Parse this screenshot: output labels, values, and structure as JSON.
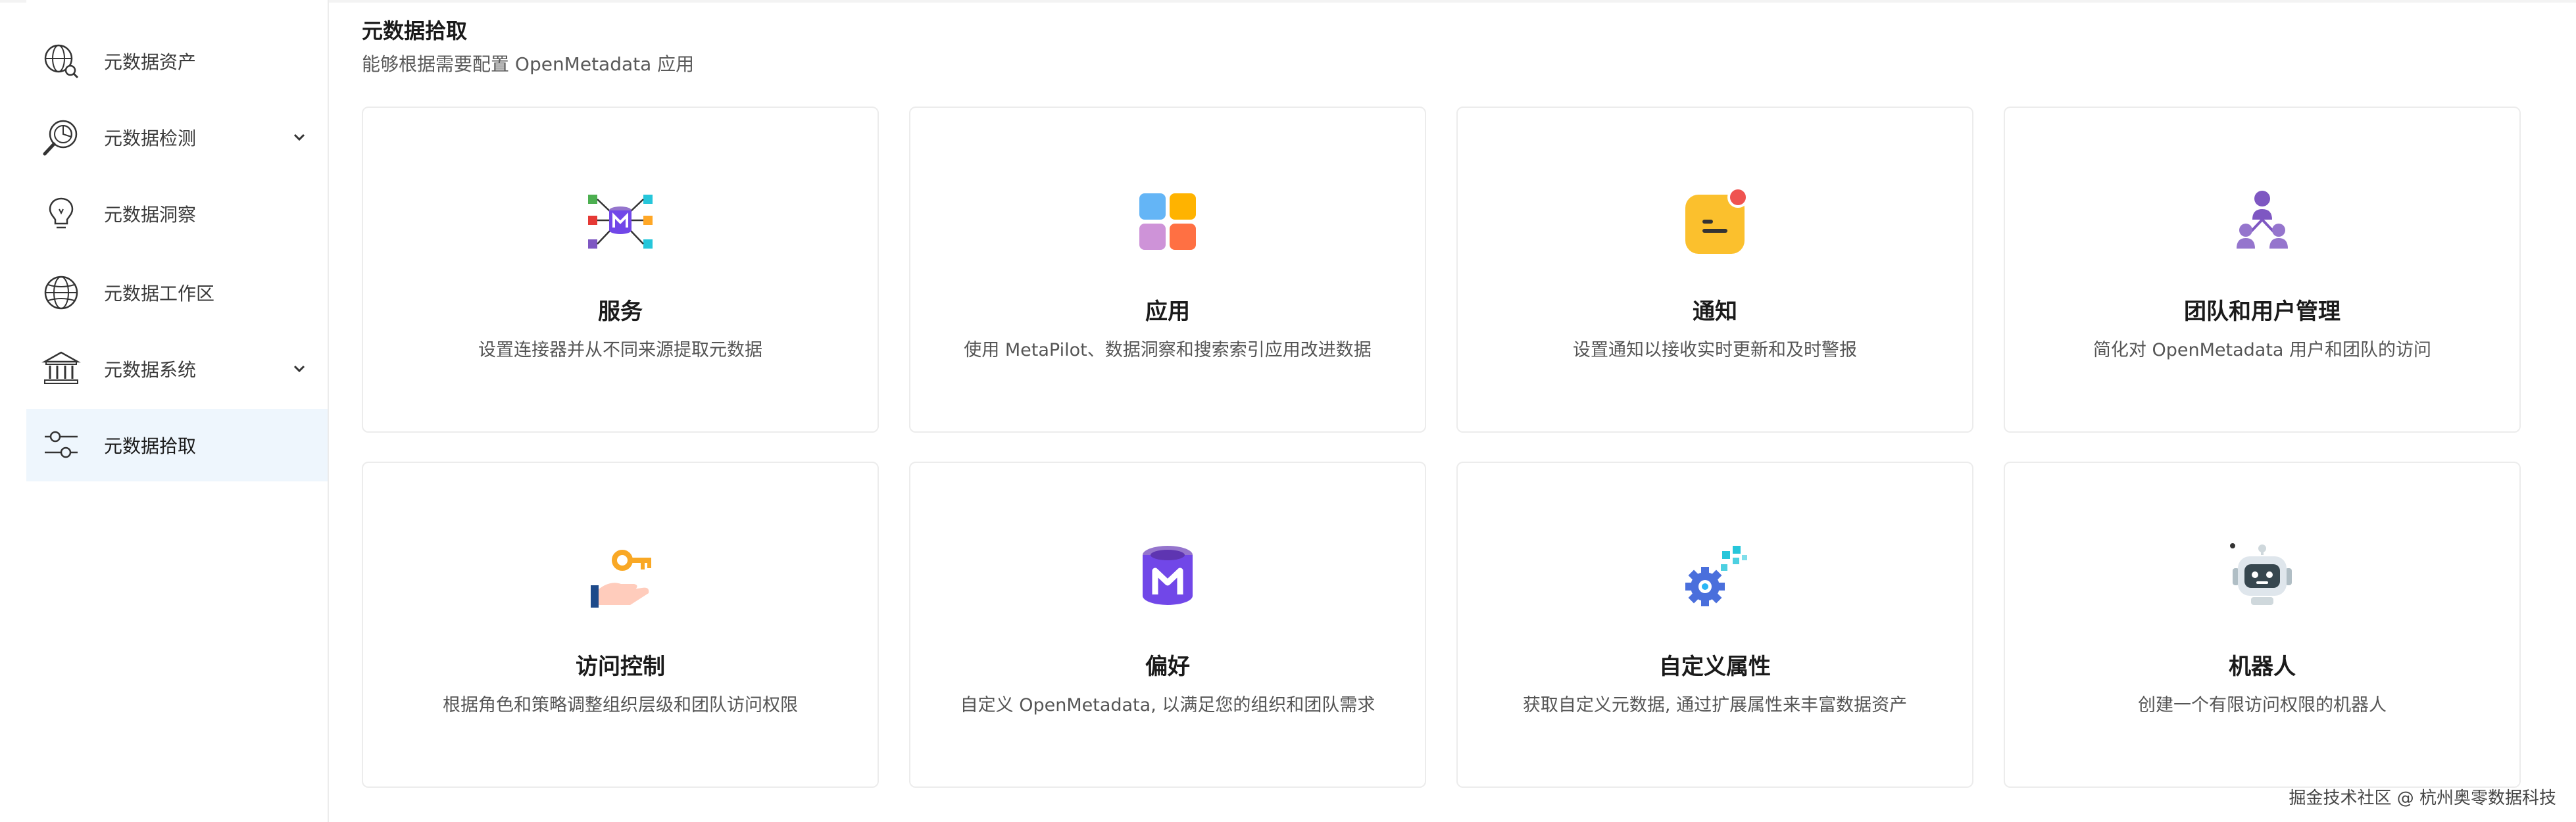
{
  "sidebar": {
    "items": [
      {
        "label": "元数据资产",
        "icon": "globe-search-icon",
        "expandable": false,
        "active": false
      },
      {
        "label": "元数据检测",
        "icon": "magnifier-chart-icon",
        "expandable": true,
        "active": false
      },
      {
        "label": "元数据洞察",
        "icon": "lightbulb-icon",
        "expandable": false,
        "active": false
      },
      {
        "label": "元数据工作区",
        "icon": "globe-icon",
        "expandable": false,
        "active": false
      },
      {
        "label": "元数据系统",
        "icon": "bank-building-icon",
        "expandable": true,
        "active": false
      },
      {
        "label": "元数据拾取",
        "icon": "sliders-icon",
        "expandable": false,
        "active": true
      }
    ]
  },
  "main": {
    "title": "元数据拾取",
    "subtitle": "能够根据需要配置 OpenMetadata 应用"
  },
  "cards": [
    {
      "title": "服务",
      "desc": "设置连接器并从不同来源提取元数据",
      "icon": "services-network-icon"
    },
    {
      "title": "应用",
      "desc": "使用 MetaPilot、数据洞察和搜索索引应用改进数据",
      "icon": "apps-grid-icon"
    },
    {
      "title": "通知",
      "desc": "设置通知以接收实时更新和及时警报",
      "icon": "notification-message-icon"
    },
    {
      "title": "团队和用户管理",
      "desc": "简化对 OpenMetadata 用户和团队的访问",
      "icon": "team-users-icon"
    },
    {
      "title": "访问控制",
      "desc": "根据角色和策略调整组织层级和团队访问权限",
      "icon": "key-hand-icon"
    },
    {
      "title": "偏好",
      "desc": "自定义 OpenMetadata, 以满足您的组织和团队需求",
      "icon": "openmetadata-logo-icon"
    },
    {
      "title": "自定义属性",
      "desc": "获取自定义元数据, 通过扩展属性来丰富数据资产",
      "icon": "gear-pixels-icon"
    },
    {
      "title": "机器人",
      "desc": "创建一个有限访问权限的机器人",
      "icon": "robot-icon"
    }
  ],
  "watermark": "掘金技术社区 @ 杭州奥零数据科技",
  "colors": {
    "active_bg": "#eef6fd",
    "accent_purple": "#7147e8",
    "border": "#ececec"
  }
}
